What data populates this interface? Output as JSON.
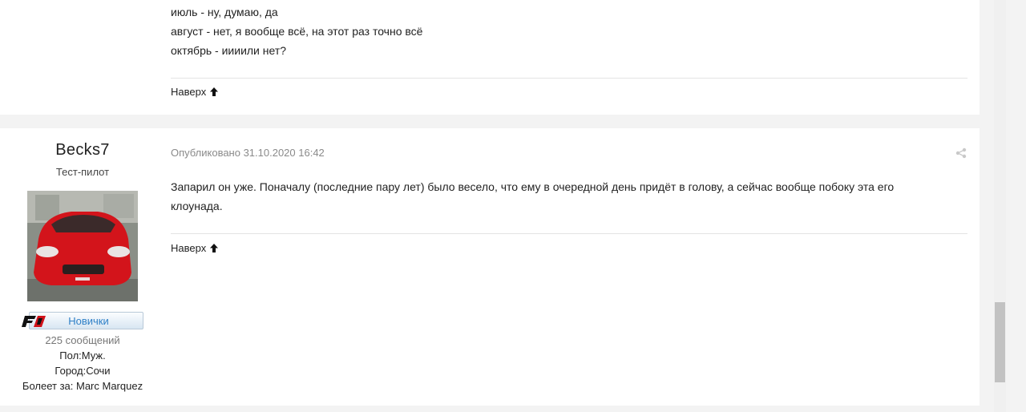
{
  "previous_post": {
    "lines": [
      "июль - ну, думаю, да",
      "август - нет, я вообще всё, на этот раз точно всё",
      "октябрь - иииили нет?"
    ],
    "top_link": "Наверх"
  },
  "post": {
    "author": {
      "name": "Becks7",
      "title": "Тест-пилот",
      "rank": "Новички",
      "posts_count": "225 сообщений",
      "gender": "Пол:Муж.",
      "city": "Город:Сочи",
      "fan_of": "Болеет за: Marc Marquez"
    },
    "date": "Опубликовано 31.10.2020 16:42",
    "content_lines": [
      "Запарил он уже. Поначалу (последние пару лет) было весело, что ему в очередной день придёт в голову, а сейчас вообще побоку эта его",
      "клоунада."
    ],
    "top_link": "Наверх"
  },
  "icons": {
    "up_arrow": "arrow-up-icon",
    "share": "share-icon",
    "rank_logo": "f1-logo"
  },
  "colors": {
    "accent": "#2f80c7",
    "muted_text": "#8a8a8a",
    "page_bg": "#f3f3f3"
  }
}
